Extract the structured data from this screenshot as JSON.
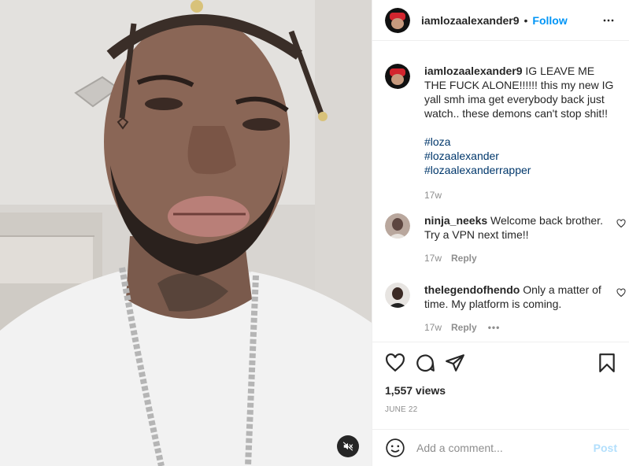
{
  "header": {
    "username": "iamlozaalexander9",
    "separator": "•",
    "follow_label": "Follow"
  },
  "caption": {
    "username": "iamlozaalexander9",
    "text": "IG LEAVE ME THE FUCK ALONE!!!!!! this my new IG yall smh ima get everybody back just watch.. these demons can't stop shit!!",
    "hashtags": [
      "#loza",
      "#lozaalexander",
      "#lozaalexanderrapper"
    ],
    "time": "17w"
  },
  "comments": [
    {
      "username": "ninja_neeks",
      "text": "Welcome back brother. Try a VPN next time!!",
      "time": "17w",
      "reply_label": "Reply"
    },
    {
      "username": "thelegendofhendo",
      "text": "Only a matter of time. My platform is coming.",
      "time": "17w",
      "reply_label": "Reply",
      "more_label": "•••"
    }
  ],
  "stats": {
    "views": "1,557 views",
    "date": "JUNE 22"
  },
  "add_comment": {
    "placeholder": "Add a comment...",
    "post_label": "Post"
  },
  "icons": {
    "like": "heart-icon",
    "comment": "comment-icon",
    "share": "share-icon",
    "save": "bookmark-icon",
    "emoji": "emoji-icon",
    "more": "more-options-icon",
    "mute": "muted-speaker-icon"
  },
  "colors": {
    "accent": "#0095f6",
    "hashtag": "#00376b",
    "muted_text": "#8e8e8e",
    "post_disabled": "#b2dffc"
  }
}
